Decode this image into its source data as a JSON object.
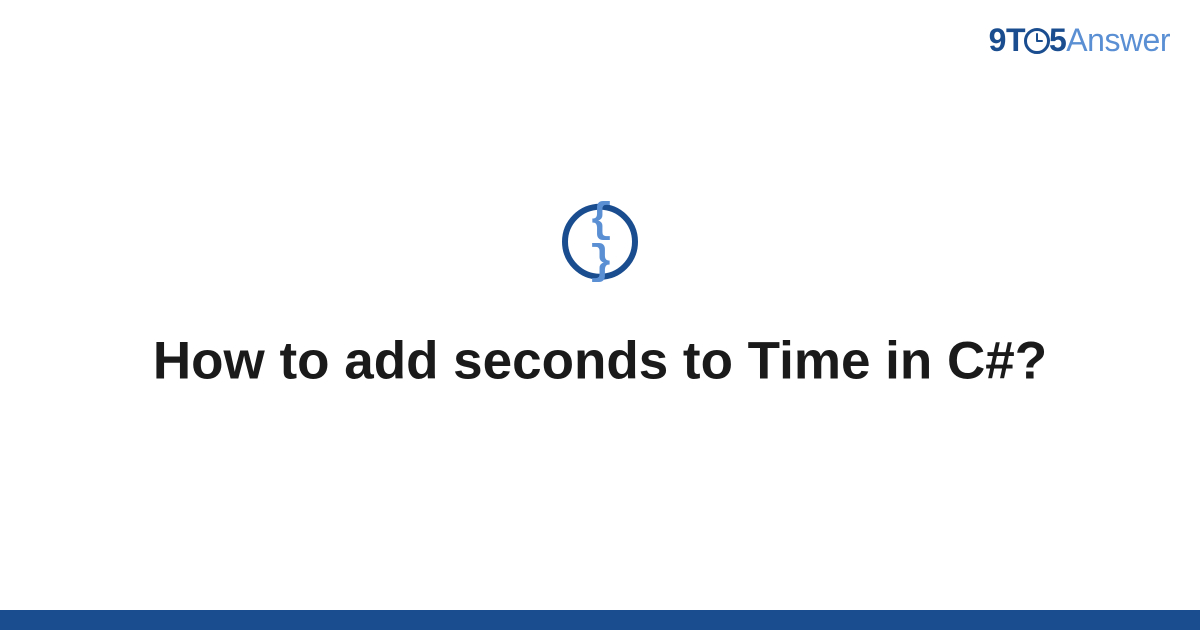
{
  "logo": {
    "part1": "9",
    "part2": "T",
    "part3": "5",
    "part4": "Answer"
  },
  "icon": {
    "name": "code-braces-icon",
    "glyph": "{ }"
  },
  "title": "How to add seconds to Time in C#?",
  "colors": {
    "primary": "#1a4d8f",
    "accent": "#5a8fd4"
  }
}
